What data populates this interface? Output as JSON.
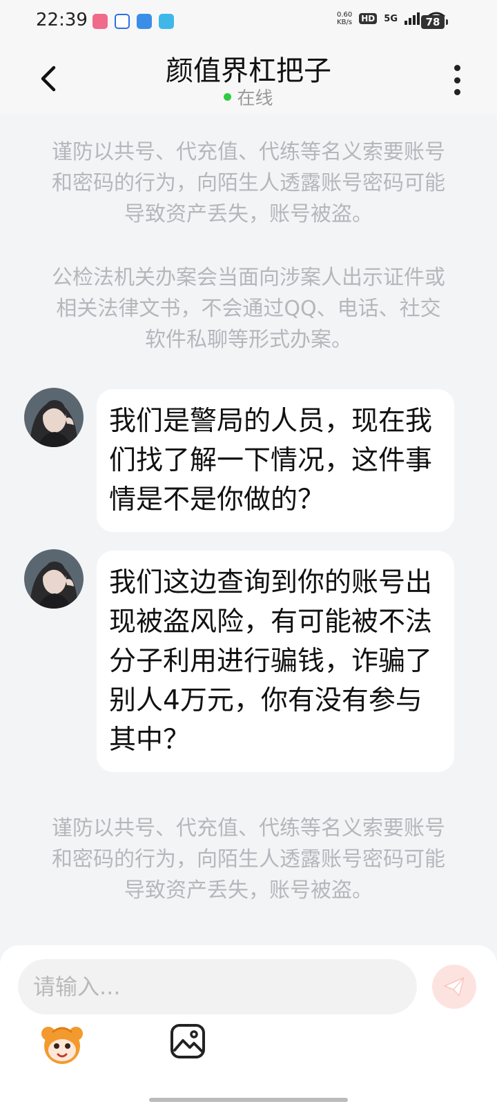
{
  "status_bar": {
    "time": "22:39",
    "net_speed_value": "0.60",
    "net_speed_unit": "KB/s",
    "hd_label": "HD",
    "network_label": "5G",
    "battery": "78"
  },
  "header": {
    "title": "颜值界杠把子",
    "status": "在线"
  },
  "notices": {
    "top_1": "谨防以共号、代充值、代练等名义索要账号和密码的行为，向陌生人透露账号密码可能导致资产丢失，账号被盗。",
    "top_2": "公检法机关办案会当面向涉案人出示证件或相关法律文书，不会通过QQ、电话、社交软件私聊等形式办案。",
    "bottom": "谨防以共号、代充值、代练等名义索要账号和密码的行为，向陌生人透露账号密码可能导致资产丢失，账号被盗。"
  },
  "messages": [
    {
      "text": "我们是警局的人员，现在我们找了解一下情况，这件事情是不是你做的？"
    },
    {
      "text": "我们这边查询到你的账号出现被盗风险，有可能被不法分子利用进行骗钱，诈骗了别人4万元，你有没有参与其中？"
    }
  ],
  "input": {
    "placeholder": "请输入..."
  },
  "colors": {
    "background": "#f3f4f6",
    "online_dot": "#2ecc40",
    "send_button": "#fde3df",
    "notice_text": "#b4b7bc"
  }
}
